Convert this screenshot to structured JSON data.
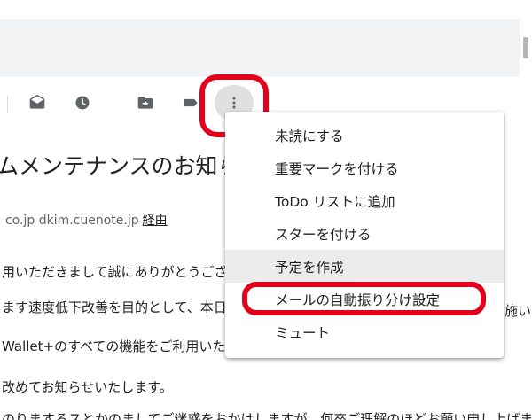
{
  "toolbar": {
    "icons": [
      "mark-as-read-icon",
      "snooze-clock-icon",
      "move-to-icon",
      "label-icon",
      "more-vertical-icon"
    ]
  },
  "email": {
    "subject": "ムメンテナンスのお知ら",
    "sender": "co.jp dkim.cuenote.jp",
    "via": "経由",
    "lines": [
      "用いただきまして誠にありがとうござ",
      "ます速度低下改善を目的として、本日",
      "Wallet+のすべての機能をご利用いただ",
      "改めてお知らせいたします。",
      "のりまするスとかのましてご迷惑をおかけしますが、何卒ご理解のほどお願い申し上げます"
    ],
    "trailing": "施い"
  },
  "menu": {
    "items": [
      "未読にする",
      "重要マークを付ける",
      "ToDo リストに追加",
      "スターを付ける",
      "予定を作成",
      "メールの自動振り分け設定",
      "ミュート"
    ],
    "hover_index": 4,
    "highlighted_index": 5
  },
  "colors": {
    "annotation_red": "#e3001b",
    "search_band": "#f1f3f4",
    "menu_hover": "#ececec",
    "icon_gray": "#5f6368"
  }
}
